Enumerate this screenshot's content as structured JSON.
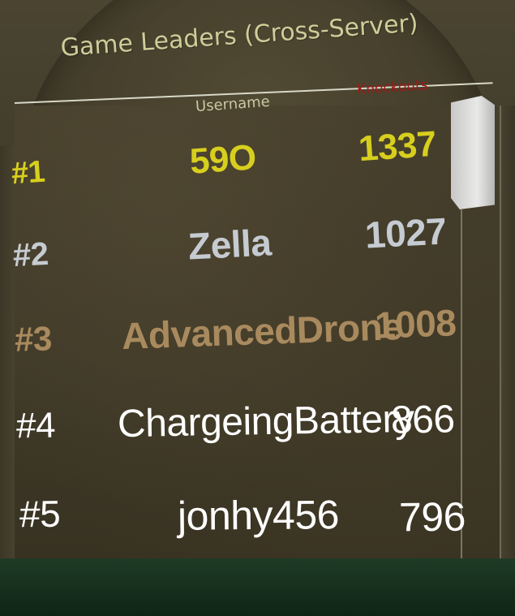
{
  "board": {
    "title": "Game Leaders (Cross-Server)",
    "columns": {
      "username": "Username",
      "knockouts": "Knockouts"
    },
    "rows": [
      {
        "rank": "#1",
        "name": "59O",
        "score": "1337",
        "tier": "gold"
      },
      {
        "rank": "#2",
        "name": "Zella",
        "score": "1027",
        "tier": "silver"
      },
      {
        "rank": "#3",
        "name": "AdvancedDrone",
        "score": "1008",
        "tier": "bronze"
      },
      {
        "rank": "#4",
        "name": "ChargeingBattery",
        "score": "866",
        "tier": "white"
      },
      {
        "rank": "#5",
        "name": "jonhy456",
        "score": "796",
        "tier": "white"
      }
    ]
  },
  "colors": {
    "gold": "#d7cf1d",
    "silver": "#c6cbd2",
    "bronze": "#a98a5e",
    "white": "#ffffff",
    "knockouts_header": "#a01818"
  }
}
